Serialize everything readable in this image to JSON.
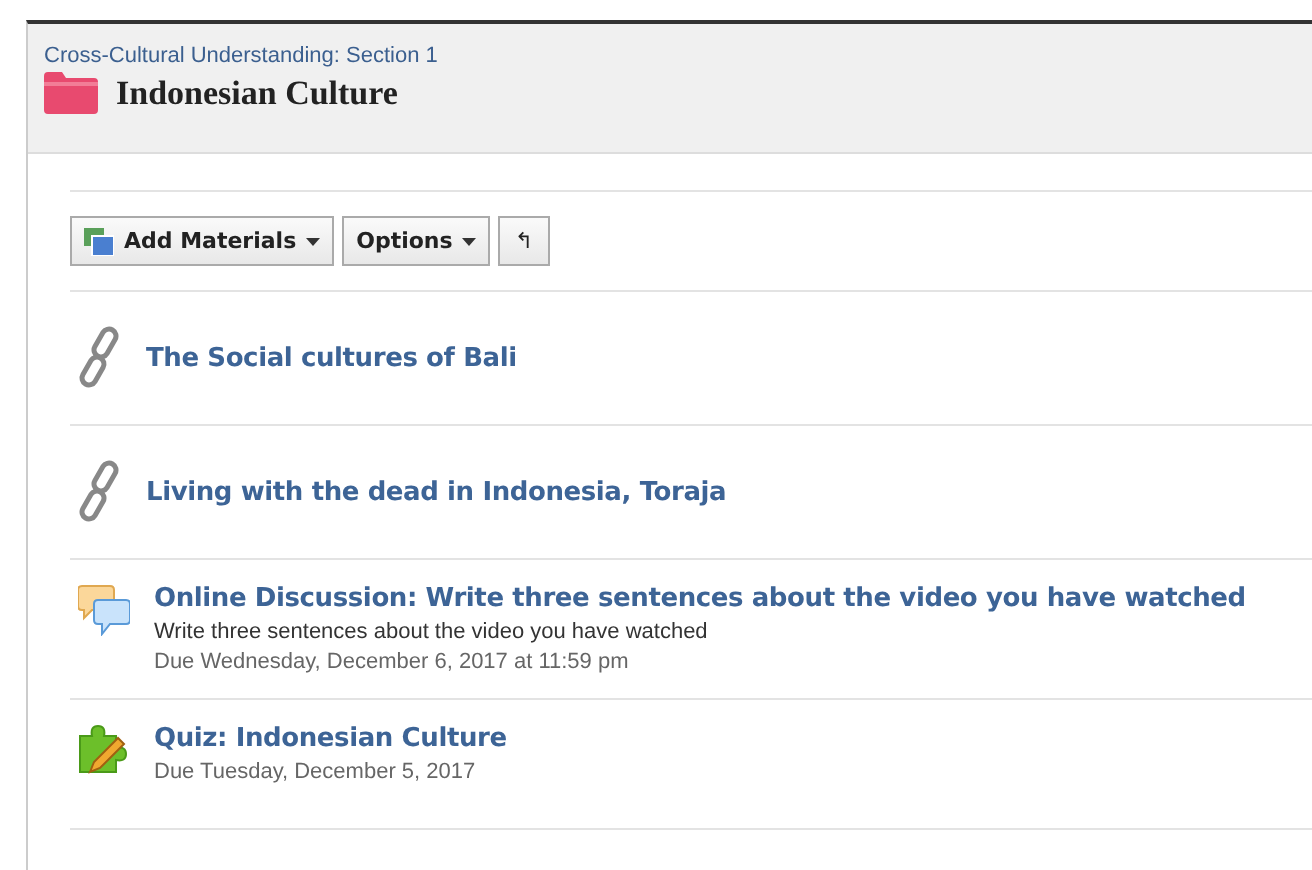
{
  "header": {
    "breadcrumb": "Cross-Cultural Understanding: Section 1",
    "title": "Indonesian Culture"
  },
  "toolbar": {
    "buttons": [
      {
        "label": "Add Materials",
        "kind": "add"
      },
      {
        "label": "Options",
        "kind": "menu"
      },
      {
        "label": "↰",
        "kind": "back"
      }
    ]
  },
  "items": [
    {
      "kind": "link",
      "title": "The Social cultures of Bali"
    },
    {
      "kind": "link",
      "title": "Living with the dead in Indonesia, Toraja"
    },
    {
      "kind": "discussion",
      "title": "Online Discussion: Write three sentences about the video you have watched",
      "description": "Write three sentences about the video you have watched",
      "due": "Due Wednesday, December 6, 2017 at 11:59 pm"
    },
    {
      "kind": "quiz",
      "title": "Quiz: Indonesian Culture",
      "due": "Due Tuesday, December 5, 2017"
    }
  ]
}
